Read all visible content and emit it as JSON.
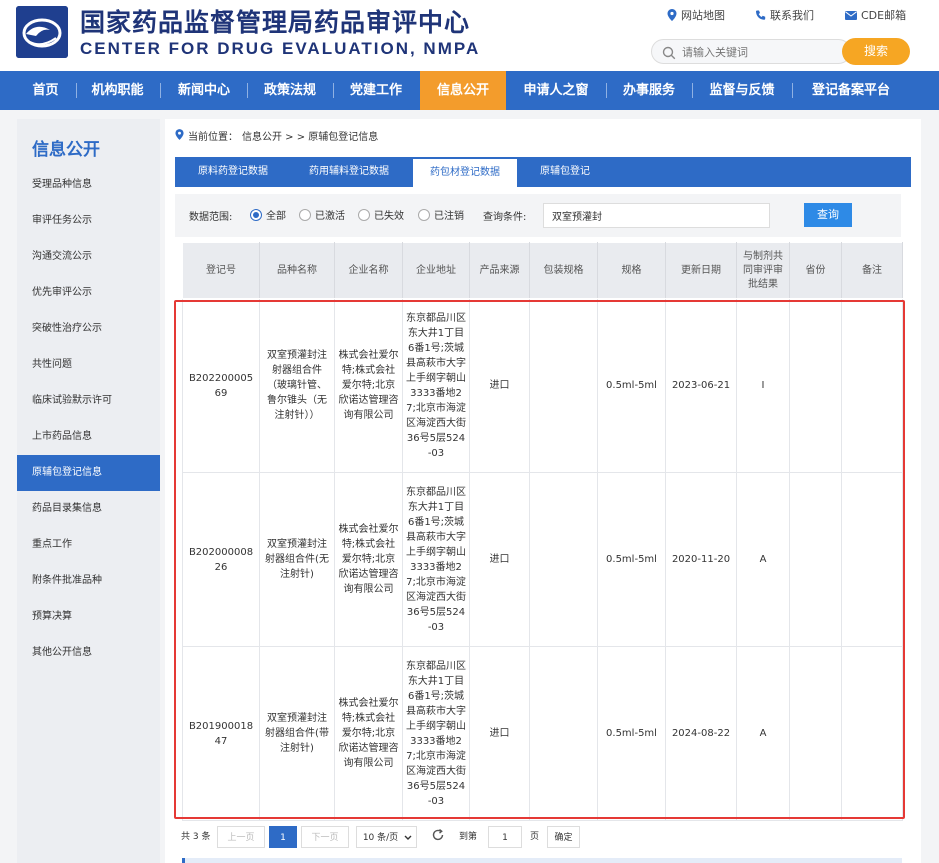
{
  "header": {
    "site_title": "国家药品监督管理局药品审评中心",
    "site_subtitle": "CENTER FOR DRUG EVALUATION, NMPA",
    "top_links": [
      "网站地图",
      "联系我们",
      "CDE邮箱"
    ],
    "search_placeholder": "请输入关键词",
    "search_button": "搜索"
  },
  "nav": {
    "items": [
      "首页",
      "机构职能",
      "新闻中心",
      "政策法规",
      "党建工作",
      "信息公开",
      "申请人之窗",
      "办事服务",
      "监督与反馈",
      "登记备案平台"
    ],
    "active": "信息公开"
  },
  "sidebar": {
    "title": "信息公开",
    "items": [
      "受理品种信息",
      "审评任务公示",
      "沟通交流公示",
      "优先审评公示",
      "突破性治疗公示",
      "共性问题",
      "临床试验默示许可",
      "上市药品信息",
      "原辅包登记信息",
      "药品目录集信息",
      "重点工作",
      "附条件批准品种",
      "预算决算",
      "其他公开信息"
    ],
    "active": "原辅包登记信息"
  },
  "breadcrumb": {
    "prefix": "当前位置：",
    "path": "信息公开 > > 原辅包登记信息"
  },
  "tabs": {
    "items": [
      "原料药登记数据",
      "药用辅料登记数据",
      "药包材登记数据",
      "原辅包登记"
    ],
    "active": "药包材登记数据"
  },
  "filter": {
    "scope_label": "数据范围:",
    "options": [
      "全部",
      "已激活",
      "已失效",
      "已注销"
    ],
    "selected": "全部",
    "query_label": "查询条件:",
    "query_value": "双室预灌封",
    "query_button": "查询"
  },
  "table": {
    "headers": [
      "登记号",
      "品种名称",
      "企业名称",
      "企业地址",
      "产品来源",
      "包装规格",
      "规格",
      "更新日期",
      "与制剂共同审评审批结果",
      "省份",
      "备注"
    ],
    "rows": [
      [
        "B20220000569",
        "双室预灌封注射器组合件（玻璃针管、鲁尔锥头（无注射针））",
        "株式会社爱尔特;株式会社爱尔特;北京欣诺达管理咨询有限公司",
        "东京都品川区东大井1丁目6番1号;茨城县高萩市大字上手纲字朝山3333番地27;北京市海淀区海淀西大街36号5层524-03",
        "进口",
        "",
        "0.5ml-5ml",
        "2023-06-21",
        "I",
        "",
        ""
      ],
      [
        "B20200000826",
        "双室预灌封注射器组合件(无注射针)",
        "株式会社爱尔特;株式会社爱尔特;北京欣诺达管理咨询有限公司",
        "东京都品川区东大井1丁目6番1号;茨城县高萩市大字上手纲字朝山3333番地27;北京市海淀区海淀西大街36号5层524-03",
        "进口",
        "",
        "0.5ml-5ml",
        "2020-11-20",
        "A",
        "",
        ""
      ],
      [
        "B20190001847",
        "双室预灌封注射器组合件(带注射针)",
        "株式会社爱尔特;株式会社爱尔特;北京欣诺达管理咨询有限公司",
        "东京都品川区东大井1丁目6番1号;茨城县高萩市大字上手纲字朝山3333番地27;北京市海淀区海淀西大街36号5层524-03",
        "进口",
        "",
        "0.5ml-5ml",
        "2024-08-22",
        "A",
        "",
        ""
      ]
    ]
  },
  "pagination": {
    "total": "共 3 条",
    "prev": "上一页",
    "current": "1",
    "next": "下一页",
    "page_size": "10 条/页",
    "goto_label": "到第",
    "goto_value": "1",
    "page_unit": "页",
    "confirm": "确定"
  },
  "colors": {
    "primary": "#2e6bc6",
    "accent": "#f39c2c",
    "highlight": "#e53935"
  }
}
